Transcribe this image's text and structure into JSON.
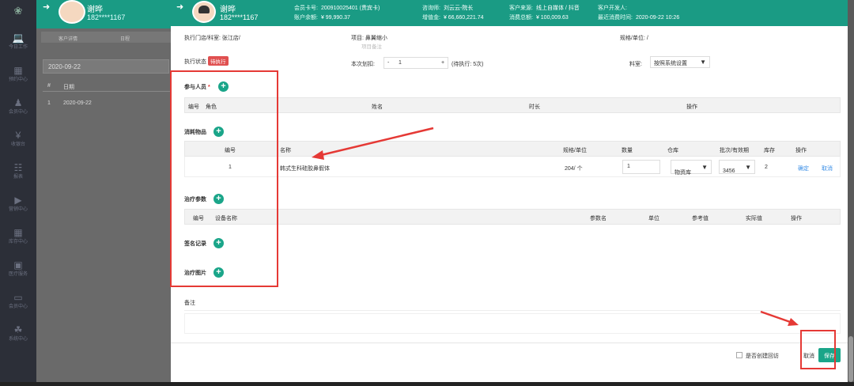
{
  "sidebar": {
    "items": [
      {
        "icon": "laptop-icon",
        "glyph": "💻",
        "label": "今日工作"
      },
      {
        "icon": "calendar-icon",
        "glyph": "▦",
        "label": "预约中心"
      },
      {
        "icon": "users-icon",
        "glyph": "♟",
        "label": "会员中心"
      },
      {
        "icon": "yen-icon",
        "glyph": "¥",
        "label": "收银台"
      },
      {
        "icon": "chart-icon",
        "glyph": "☷",
        "label": "报表"
      },
      {
        "icon": "megaphone-icon",
        "glyph": "▶",
        "label": "营销中心"
      },
      {
        "icon": "grid-icon",
        "glyph": "▦",
        "label": "库存中心"
      },
      {
        "icon": "briefcase-icon",
        "glyph": "▣",
        "label": "医疗服务"
      },
      {
        "icon": "card-icon",
        "glyph": "▭",
        "label": "会员中心"
      },
      {
        "icon": "org-icon",
        "glyph": "☘",
        "label": "系统中心"
      }
    ]
  },
  "background": {
    "name": "谢晔",
    "phone": "182****1167",
    "tabs": [
      "客户详情",
      "日程"
    ],
    "date": "2020-09-22",
    "table_header": [
      "#",
      "日期"
    ],
    "table_row": [
      "1",
      "2020-09-22"
    ]
  },
  "modal": {
    "header": {
      "name": "谢晔",
      "phone": "182****1167",
      "card_no_label": "会员卡号:",
      "card_no": "200910025401 (贵宾卡)",
      "balance_label": "账户余额:",
      "balance": "¥ 99,990.37",
      "consultant_label": "咨询师:",
      "consultant": "刘云云-院长",
      "credit_label": "增值金:",
      "credit": "¥ 66,660,221.74",
      "source_label": "客户来源:",
      "source": "线上自媒体 / 抖音",
      "total_label": "消费总额:",
      "total": "¥ 100,009.63",
      "developer_label": "客户开发人:",
      "developer": "",
      "last_label": "最近消费时间:",
      "last": "2020-09-22 10:26"
    },
    "exec_store_label": "执行门店/科室:",
    "exec_store": "张江店/",
    "project_label": "项目:",
    "project": "鼻翼缩小",
    "project_note": "项目备注",
    "spec_label": "规格/单位:",
    "spec": "/",
    "status_label": "执行状态",
    "status_badge": "待执行",
    "deduct_label": "本次划扣:",
    "deduct_minus": "-",
    "deduct_value": "1",
    "deduct_plus": "+",
    "pending": "(待执行: 5次)",
    "material_label": "料室:",
    "material_value": "按照系统设置",
    "participants": {
      "title": "参与人员",
      "required": "*",
      "columns": [
        "编号",
        "角色",
        "姓名",
        "时长",
        "操作"
      ]
    },
    "consumables": {
      "title": "消耗物品",
      "columns": [
        "编号",
        "名称",
        "规格/单位",
        "数量",
        "仓库",
        "批次/有效期",
        "库存",
        "操作"
      ],
      "rows": [
        {
          "no": "1",
          "name": "韩式生科硅胶鼻假体",
          "spec": "204/ 个",
          "qty": "1",
          "warehouse": "物资库",
          "batch": "3456",
          "stock": "2",
          "confirm": "确定",
          "cancel": "取消"
        }
      ]
    },
    "params": {
      "title": "治疗参数",
      "columns": [
        "编号",
        "设备名称",
        "参数名",
        "单位",
        "参考值",
        "实际值",
        "操作"
      ]
    },
    "sign_title": "签名记录",
    "photo_title": "治疗图片",
    "notes_label": "备注",
    "followup_label": "是否创建回访",
    "cancel_button": "取消",
    "save_button": "保存"
  },
  "colors": {
    "accent": "#1aa589",
    "annotation": "#e53935"
  }
}
